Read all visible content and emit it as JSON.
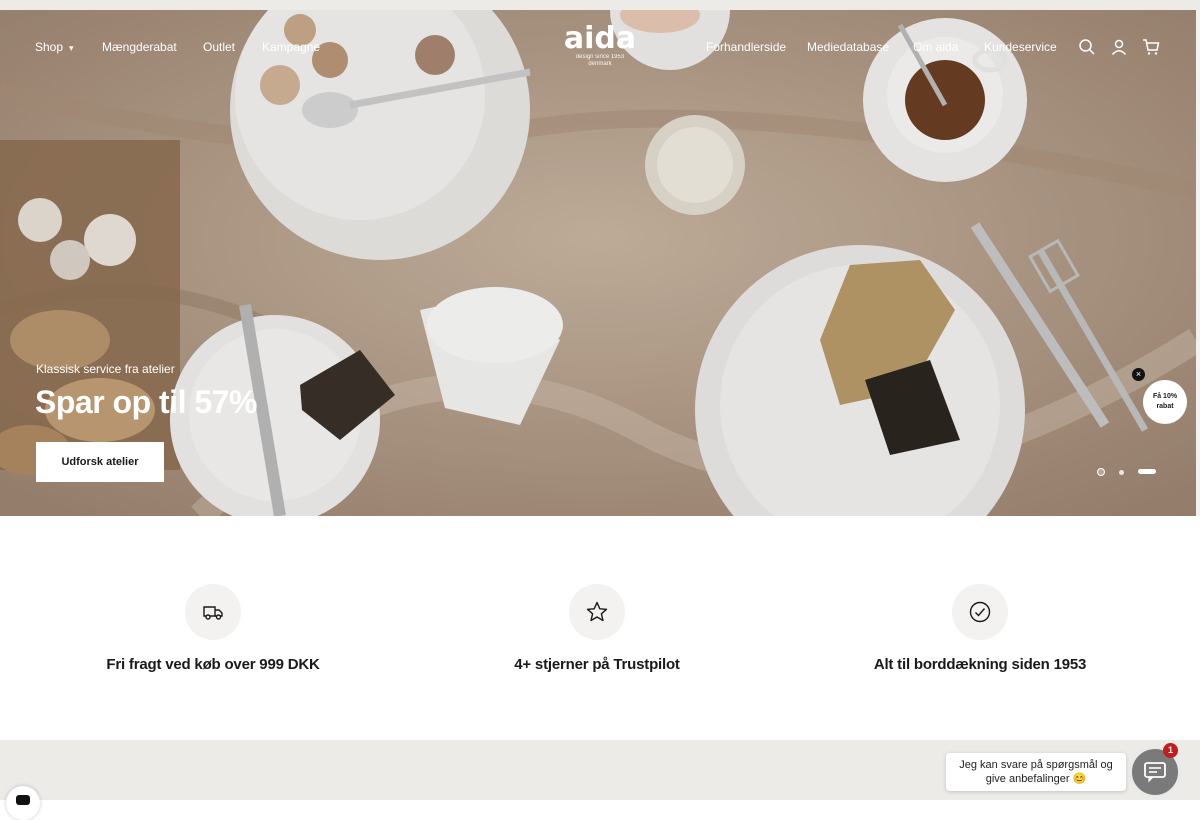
{
  "header": {
    "logo_text": "aida",
    "logo_tagline_1": "design since 1953",
    "logo_tagline_2": "denmark",
    "nav_left": [
      "Shop",
      "Mængderabat",
      "Outlet",
      "Kampagne"
    ],
    "nav_right": [
      "Forhandlerside",
      "Mediedatabase",
      "Om aida",
      "Kundeservice"
    ],
    "icons": [
      "search-icon",
      "account-icon",
      "cart-icon"
    ]
  },
  "hero": {
    "kicker": "Klassisk service fra atelier",
    "title": "Spar op til 57%",
    "cta_label": "Udforsk atelier",
    "slide_count": 3,
    "active_slide": 3
  },
  "promo": {
    "line1": "Få 10%",
    "line2": "rabat",
    "close": "×"
  },
  "features": [
    {
      "icon": "truck-icon",
      "label": "Fri fragt ved køb over 999 DKK"
    },
    {
      "icon": "star-icon",
      "label": "4+ stjerner på Trustpilot"
    },
    {
      "icon": "check-circle-icon",
      "label": "Alt til borddækning siden 1953"
    }
  ],
  "chat": {
    "line1": "Jeg kan svare på spørgsmål og",
    "line2": "give anbefalinger 😊",
    "badge": "1"
  },
  "colors": {
    "hero_linen": "#b59f8a",
    "plate": "#f4f3f1",
    "feature_circle": "#f3f2f0",
    "footer_band": "#ecebe8",
    "badge_red": "#c21c1c"
  }
}
